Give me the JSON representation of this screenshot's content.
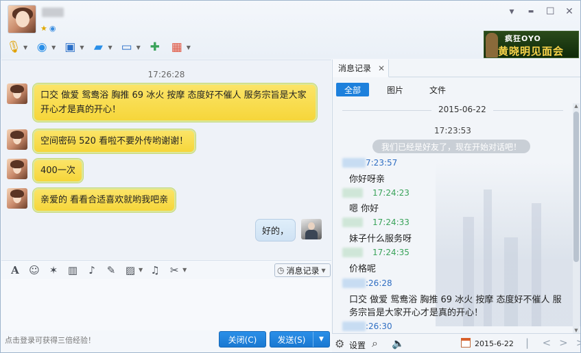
{
  "contact": {
    "name": ""
  },
  "window_buttons": {
    "menu": "▾",
    "minimize": "▬",
    "maximize": "☐",
    "close": "✕"
  },
  "ad": {
    "line1": "疯狂OYO",
    "line2": "黄晓明见面会"
  },
  "chat": {
    "time": "17:26:28",
    "messages_in": [
      {
        "text": "口交 做爱  鸳鸯浴  胸推  69  冰火 按摩 态度好不催人 服务宗旨是大家开心才是真的开心！"
      },
      {
        "text": "空间密码  520  看啦不要外传哟谢谢！"
      },
      {
        "text": "400一次"
      },
      {
        "text": "亲爱的 看看合适喜欢就哟我吧亲"
      }
    ],
    "message_out": {
      "text": "好的，"
    }
  },
  "input_toolbar": {
    "history_label": "消息记录"
  },
  "footer": {
    "tip": "点击登录可获得三倍经验！",
    "close_label": "关闭(C)",
    "send_label": "发送(S)"
  },
  "history": {
    "tab_label": "消息记录",
    "filters": [
      "全部",
      "图片",
      "文件"
    ],
    "date": "2015-06-22",
    "first_time": "17:23:53",
    "system_msg": "我们已经是好友了，现在开始对话吧！",
    "entries": [
      {
        "ts": "7:23:57",
        "mine": false,
        "text": "你好呀亲"
      },
      {
        "ts": "17:24:23",
        "mine": true,
        "text": "嗯 你好"
      },
      {
        "ts": "17:24:33",
        "mine": true,
        "text": "妹子什么服务呀"
      },
      {
        "ts": "17:24:35",
        "mine": true,
        "text": "价格呢"
      },
      {
        "ts": ":26:28",
        "mine": false,
        "text": "口交 做爱  鸳鸯浴  胸推  69  冰火 按摩 态度好不催人 服务宗旨是大家开心才是真的开心！"
      },
      {
        "ts": ":26:30",
        "mine": false,
        "text": ""
      }
    ],
    "footer": {
      "settings_label": "设置",
      "date_label": "2015-6-22"
    }
  }
}
